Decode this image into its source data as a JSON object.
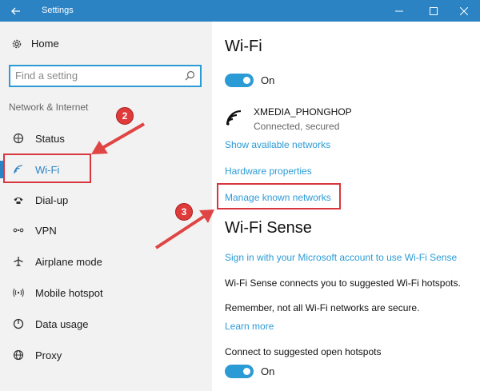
{
  "window": {
    "title": "Settings"
  },
  "sidebar": {
    "home_label": "Home",
    "search_placeholder": "Find a setting",
    "section_title": "Network & Internet",
    "items": [
      {
        "label": "Status",
        "icon": "globe-status-icon"
      },
      {
        "label": "Wi-Fi",
        "icon": "wifi-icon"
      },
      {
        "label": "Dial-up",
        "icon": "phone-icon"
      },
      {
        "label": "VPN",
        "icon": "vpn-icon"
      },
      {
        "label": "Airplane mode",
        "icon": "airplane-icon"
      },
      {
        "label": "Mobile hotspot",
        "icon": "hotspot-icon"
      },
      {
        "label": "Data usage",
        "icon": "data-usage-icon"
      },
      {
        "label": "Proxy",
        "icon": "globe-icon"
      }
    ]
  },
  "main": {
    "title": "Wi-Fi",
    "wifi_toggle": "On",
    "network": {
      "name": "XMEDIA_PHONGHOP",
      "status": "Connected, secured"
    },
    "show_networks": "Show available networks",
    "hardware_properties": "Hardware properties",
    "manage_networks": "Manage known networks",
    "sense_title": "Wi-Fi Sense",
    "sense_signin": "Sign in with your Microsoft account to use Wi-Fi Sense",
    "sense_desc": "Wi-Fi Sense connects you to suggested Wi-Fi hotspots.",
    "sense_warning": "Remember, not all Wi-Fi networks are secure.",
    "learn_more": "Learn more",
    "hotspots_label": "Connect to suggested open hotspots",
    "hotspots_toggle": "On"
  },
  "annotations": {
    "step2": "2",
    "step3": "3"
  },
  "colors": {
    "accent": "#2b83c4",
    "link": "#2b9bd6",
    "highlight": "#d9353f",
    "arrow": "#e04545"
  }
}
